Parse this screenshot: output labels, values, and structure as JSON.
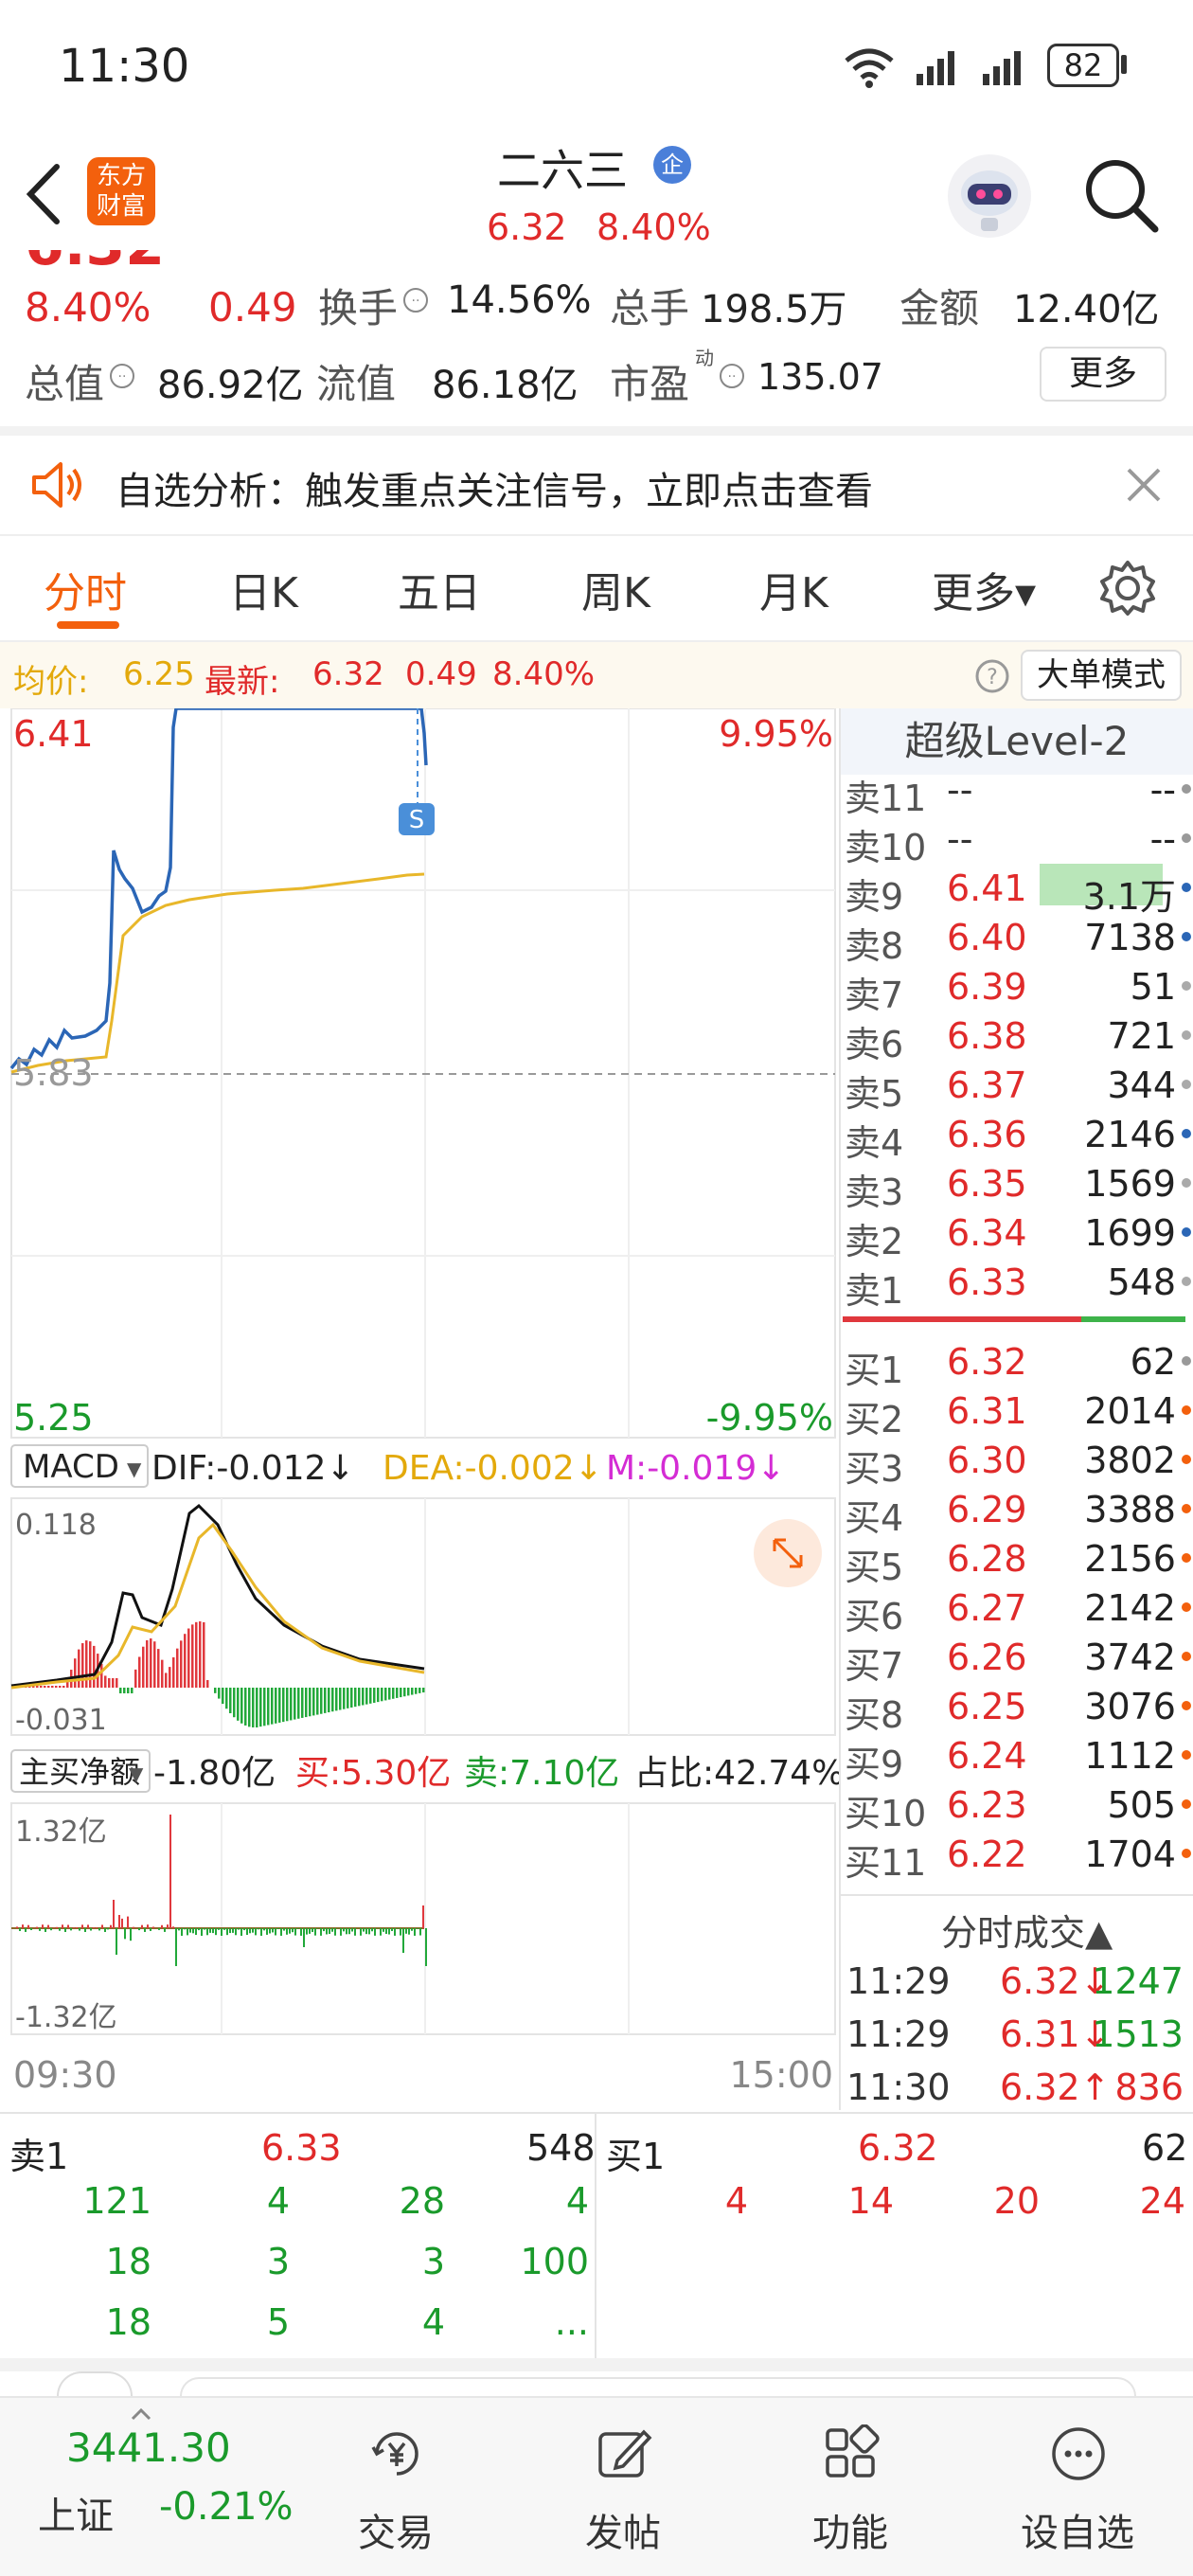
{
  "status_bar": {
    "time": "11:30",
    "battery": "82"
  },
  "header": {
    "logo_line1": "东方",
    "logo_line2": "财富",
    "stock_name": "二六三",
    "stock_badge": "企",
    "price": "6.32",
    "change_pct": "8.40%"
  },
  "quote": {
    "change_pct": "8.40%",
    "change_abs": "0.49",
    "turnover_label": "换手",
    "turnover_value": "14.56%",
    "volume_label": "总手",
    "volume_value": "198.5万",
    "amount_label": "金额",
    "amount_value": "12.40亿",
    "total_cap_label": "总值",
    "total_cap_value": "86.92亿",
    "float_cap_label": "流值",
    "float_cap_value": "86.18亿",
    "pe_label": "市盈",
    "pe_sup": "动",
    "pe_value": "135.07",
    "more_label": "更多"
  },
  "banner": {
    "text": "自选分析：触发重点关注信号，立即点击查看"
  },
  "tabs": [
    {
      "label": "分时"
    },
    {
      "label": "日K"
    },
    {
      "label": "五日"
    },
    {
      "label": "周K"
    },
    {
      "label": "月K"
    },
    {
      "label": "更多▾"
    }
  ],
  "info_bar": {
    "avg_label": "均价:",
    "avg_value": "6.25",
    "latest_label": "最新:",
    "latest_value": "6.32",
    "change_abs": "0.49",
    "change_pct": "8.40%",
    "big_order_label": "大单模式"
  },
  "price_chart": {
    "high": "6.41",
    "high_pct": "9.95%",
    "base": "5.83",
    "low": "5.25",
    "low_pct": "-9.95%",
    "marker": "S"
  },
  "macd": {
    "selector": "MACD",
    "dif": "DIF:-0.012↓",
    "dea": "DEA:-0.002↓",
    "m": "M:-0.019↓",
    "max": "0.118",
    "min": "-0.031"
  },
  "flow": {
    "selector": "主买净额",
    "net": "-1.80亿",
    "buy": "买:5.30亿",
    "sell": "卖:7.10亿",
    "ratio": "占比:42.74%",
    "max": "1.32亿",
    "min": "-1.32亿"
  },
  "time_axis": {
    "start": "09:30",
    "end": "15:00"
  },
  "level2": {
    "title": "超级Level-2",
    "asks": [
      {
        "label": "卖11",
        "price": "--",
        "vol": "--"
      },
      {
        "label": "卖10",
        "price": "--",
        "vol": "--"
      },
      {
        "label": "卖9",
        "price": "6.41",
        "vol": "3.1万"
      },
      {
        "label": "卖8",
        "price": "6.40",
        "vol": "7138"
      },
      {
        "label": "卖7",
        "price": "6.39",
        "vol": "51"
      },
      {
        "label": "卖6",
        "price": "6.38",
        "vol": "721"
      },
      {
        "label": "卖5",
        "price": "6.37",
        "vol": "344"
      },
      {
        "label": "卖4",
        "price": "6.36",
        "vol": "2146"
      },
      {
        "label": "卖3",
        "price": "6.35",
        "vol": "1569"
      },
      {
        "label": "卖2",
        "price": "6.34",
        "vol": "1699"
      },
      {
        "label": "卖1",
        "price": "6.33",
        "vol": "548"
      }
    ],
    "bids": [
      {
        "label": "买1",
        "price": "6.32",
        "vol": "62"
      },
      {
        "label": "买2",
        "price": "6.31",
        "vol": "2014"
      },
      {
        "label": "买3",
        "price": "6.30",
        "vol": "3802"
      },
      {
        "label": "买4",
        "price": "6.29",
        "vol": "3388"
      },
      {
        "label": "买5",
        "price": "6.28",
        "vol": "2156"
      },
      {
        "label": "买6",
        "price": "6.27",
        "vol": "2142"
      },
      {
        "label": "买7",
        "price": "6.26",
        "vol": "3742"
      },
      {
        "label": "买8",
        "price": "6.25",
        "vol": "3076"
      },
      {
        "label": "买9",
        "price": "6.24",
        "vol": "1112"
      },
      {
        "label": "买10",
        "price": "6.23",
        "vol": "505"
      },
      {
        "label": "买11",
        "price": "6.22",
        "vol": "1704"
      }
    ],
    "trades_title": "分时成交▲",
    "trades": [
      {
        "time": "11:29",
        "price": "6.32↓",
        "vol": "1247"
      },
      {
        "time": "11:29",
        "price": "6.31↓",
        "vol": "1513"
      },
      {
        "time": "11:30",
        "price": "6.32↑",
        "vol": "836"
      }
    ]
  },
  "queue": {
    "sell_label": "卖1",
    "sell_price": "6.33",
    "sell_vol": "548",
    "buy_label": "买1",
    "buy_price": "6.32",
    "buy_vol": "62",
    "sell_rows": [
      [
        "121",
        "4",
        "28",
        "4"
      ],
      [
        "18",
        "3",
        "3",
        "100"
      ],
      [
        "18",
        "5",
        "4",
        "..."
      ]
    ],
    "buy_rows": [
      [
        "4",
        "14",
        "20",
        "24"
      ]
    ]
  },
  "bottom_bar": {
    "index_value": "3441.30",
    "index_name": "上证",
    "index_change": "-0.21%",
    "trade": "交易",
    "post": "发帖",
    "function": "功能",
    "watchlist": "设自选"
  }
}
